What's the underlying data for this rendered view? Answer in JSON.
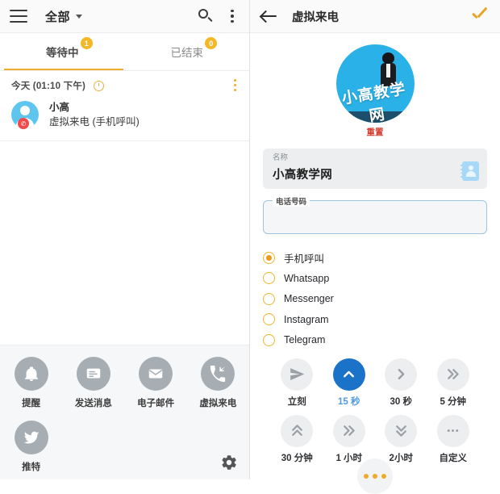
{
  "left_panel": {
    "appbar": {
      "menu_icon": "hamburger-menu-icon",
      "title": "全部",
      "dropdown_icon": "chevron-down-icon",
      "search_icon": "search-icon",
      "overflow_icon": "more-vertical-icon"
    },
    "tabs": [
      {
        "label": "等待中",
        "badge": "1",
        "active": true
      },
      {
        "label": "已结束",
        "badge": "0",
        "active": false
      }
    ],
    "list": {
      "date_header": "今天 (01:10 下午)",
      "clock_icon": "clock-icon",
      "row_menu_icon": "more-vertical-icon",
      "items": [
        {
          "name": "小高",
          "subtitle": "虚拟来电 (手机呼叫)",
          "avatar_icon": "person-avatar-icon",
          "badge_icon": "phone-icon"
        }
      ]
    },
    "shortcuts": [
      {
        "label": "提醒",
        "icon": "bell-icon"
      },
      {
        "label": "发送消息",
        "icon": "message-icon"
      },
      {
        "label": "电子邮件",
        "icon": "envelope-icon"
      },
      {
        "label": "虚拟来电",
        "icon": "phone-incoming-icon"
      },
      {
        "label": "推特",
        "icon": "twitter-bird-icon"
      }
    ],
    "settings_icon": "gear-icon"
  },
  "right_panel": {
    "appbar": {
      "back_icon": "arrow-left-icon",
      "title": "虚拟来电",
      "confirm_icon": "check-icon"
    },
    "logo": {
      "text": "小高教学网",
      "reset_label": "重置"
    },
    "name_field": {
      "label": "名称",
      "value": "小高教学网",
      "contact_icon": "contact-book-icon"
    },
    "phone_field": {
      "label": "电话号码",
      "value": "",
      "placeholder": ""
    },
    "call_types": [
      {
        "label": "手机呼叫",
        "selected": true
      },
      {
        "label": "Whatsapp",
        "selected": false
      },
      {
        "label": "Messenger",
        "selected": false
      },
      {
        "label": "Instagram",
        "selected": false
      },
      {
        "label": "Telegram",
        "selected": false
      }
    ],
    "timing_options": [
      {
        "label": "立刻",
        "icon": "send-icon",
        "selected": false
      },
      {
        "label": "15 秒",
        "icon": "chevron-up-icon",
        "selected": true
      },
      {
        "label": "30 秒",
        "icon": "chevron-right-icon",
        "selected": false
      },
      {
        "label": "5 分钟",
        "icon": "double-chevron-right-icon",
        "selected": false
      },
      {
        "label": "30 分钟",
        "icon": "double-chevron-up-icon",
        "selected": false
      },
      {
        "label": "1 小时",
        "icon": "double-chevron-right-icon",
        "selected": false
      },
      {
        "label": "2小时",
        "icon": "double-chevron-down-icon",
        "selected": false
      },
      {
        "label": "自定义",
        "icon": "ellipsis-icon",
        "selected": false
      }
    ],
    "fab_icon": "more-horizontal-icon"
  },
  "colors": {
    "accent_orange": "#f0ad2b",
    "accent_blue": "#1a73c8",
    "avatar_blue": "#5ec6ee",
    "logo_blue": "#2ab2e8",
    "reset_red": "#d23b2e",
    "shortcut_gray": "#a6aeb3"
  }
}
